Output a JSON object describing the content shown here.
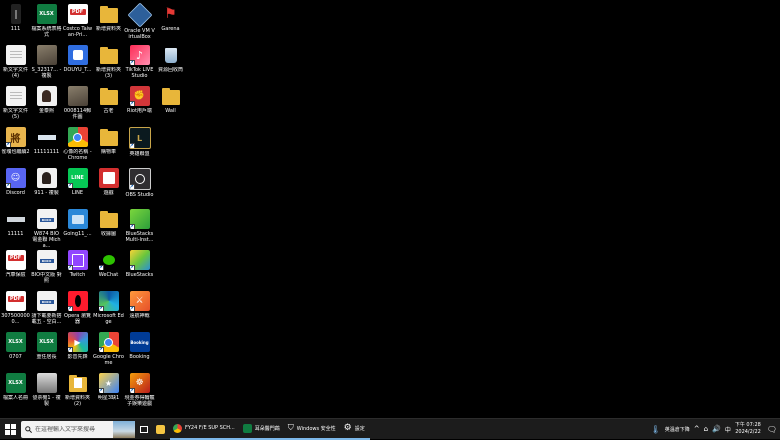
{
  "desktop": {
    "icons": [
      {
        "label": "111",
        "icon": "tiny-app-icon"
      },
      {
        "label": "檔案系統表格式",
        "icon": "xlsx-icon",
        "badge": "XLSX"
      },
      {
        "label": "Costco Taiwan-Pri...",
        "icon": "pdf-icon"
      },
      {
        "label": "新增資料夾",
        "icon": "folder-icon"
      },
      {
        "label": "Oracle VM VirtualBox",
        "icon": "virtualbox-icon"
      },
      {
        "label": "Garena",
        "icon": "garena-icon"
      },
      {
        "label": "新文字文件 (4)",
        "icon": "text-file-icon"
      },
      {
        "label": "S_32317... - 複製",
        "icon": "photo-file-icon"
      },
      {
        "label": "DOUYU_T...",
        "icon": "douyu-icon"
      },
      {
        "label": "新增資料夾 (3)",
        "icon": "folder-icon"
      },
      {
        "label": "TikTok LIVE Studio",
        "icon": "tiktok-live-icon"
      },
      {
        "label": "資源回收筒",
        "icon": "recycle-bin-icon"
      },
      {
        "label": "新文字文件 (5)",
        "icon": "text-file-icon"
      },
      {
        "label": "金泰熙",
        "icon": "portrait-file-icon"
      },
      {
        "label": "0008114郵件圖",
        "icon": "photo-file-icon"
      },
      {
        "label": "古老",
        "icon": "folder-icon"
      },
      {
        "label": "Riot用戶端",
        "icon": "riot-client-icon"
      },
      {
        "label": "Wall",
        "icon": "folder-icon"
      },
      {
        "label": "雀魂也繼續2",
        "icon": "mahjong-icon"
      },
      {
        "label": "11111111",
        "icon": "blank-image-icon"
      },
      {
        "label": "心像的名稱 - Chrome",
        "icon": "chrome-icon"
      },
      {
        "label": "購物車",
        "icon": "folder-icon"
      },
      {
        "label": "英雄聯盟",
        "icon": "league-of-legends-icon"
      },
      {
        "label": "Discord",
        "icon": "discord-icon"
      },
      {
        "label": "911 - 複製",
        "icon": "portrait-file-icon"
      },
      {
        "label": "LINE",
        "icon": "line-icon"
      },
      {
        "label": "遊戲",
        "icon": "folder-icon"
      },
      {
        "label": "OBS Studio",
        "icon": "obs-icon"
      },
      {
        "label": "11111",
        "icon": "blank-image-icon"
      },
      {
        "label": "W874 BIO 電金聯 Micha...",
        "icon": "docx-icon",
        "badge": "DOCX"
      },
      {
        "label": "Going11_...",
        "icon": "app-window-icon"
      },
      {
        "label": "收據圖",
        "icon": "folder-icon"
      },
      {
        "label": "BlueStacks Multi-Inst...",
        "icon": "bluestacks-multi-icon"
      },
      {
        "label": "汽車保險",
        "icon": "pdf-icon"
      },
      {
        "label": "BIO中文版 對照",
        "icon": "docx-icon",
        "badge": "DOCX"
      },
      {
        "label": "Twitch",
        "icon": "twitch-icon"
      },
      {
        "label": "WeChat",
        "icon": "wechat-icon"
      },
      {
        "label": "BlueStacks",
        "icon": "bluestacks-icon"
      },
      {
        "label": "3075000000...",
        "icon": "pdf-icon"
      },
      {
        "label": "請下載要新搭載五 - 空白...",
        "icon": "docx-icon",
        "badge": "DOCX"
      },
      {
        "label": "Opera 瀏覽器",
        "icon": "opera-icon"
      },
      {
        "label": "Microsoft Edge",
        "icon": "edge-icon"
      },
      {
        "label": "遠航神戰",
        "icon": "game-icon"
      },
      {
        "label": "0707",
        "icon": "xlsx-icon",
        "badge": "XLSX"
      },
      {
        "label": "重任居長",
        "icon": "xlsx-icon",
        "badge": "XLSX"
      },
      {
        "label": "影音先鋒",
        "icon": "media-player-icon"
      },
      {
        "label": "Google Chrome",
        "icon": "chrome-icon"
      },
      {
        "label": "Booking",
        "icon": "booking-icon",
        "badge": "Booking"
      },
      {
        "label": "檔案人名冊",
        "icon": "xlsx-icon",
        "badge": "XLSX"
      },
      {
        "label": "發票機1 - 複製",
        "icon": "printer-image-icon"
      },
      {
        "label": "新增資料夾 (2)",
        "icon": "folder-icon"
      },
      {
        "label": "明星3缺1",
        "icon": "mahjong-game-icon"
      },
      {
        "label": "現金券得輪寵子娛樂遊戲",
        "icon": "game-icon"
      }
    ]
  },
  "taskbar": {
    "search_placeholder": "在這裡輸入文字來搜尋",
    "apps": [
      {
        "label": "",
        "icon": "file-explorer-icon"
      },
      {
        "label": "FY24 F/E SUP SCH...",
        "icon": "chrome-icon"
      },
      {
        "label": "耳朵醫門鵡",
        "icon": "xlsx-icon"
      },
      {
        "label": "Windows 安全性",
        "icon": "shield-icon"
      },
      {
        "label": "設定",
        "icon": "gear-icon"
      }
    ],
    "tray_text": "英溫倉下降",
    "ime": "中",
    "time": "下午 07:28",
    "date": "2024/2/22"
  },
  "colors": {
    "desktop_bg": "#000000",
    "taskbar_bg": "#1c1c1c",
    "accent": "#7cb7e8"
  }
}
